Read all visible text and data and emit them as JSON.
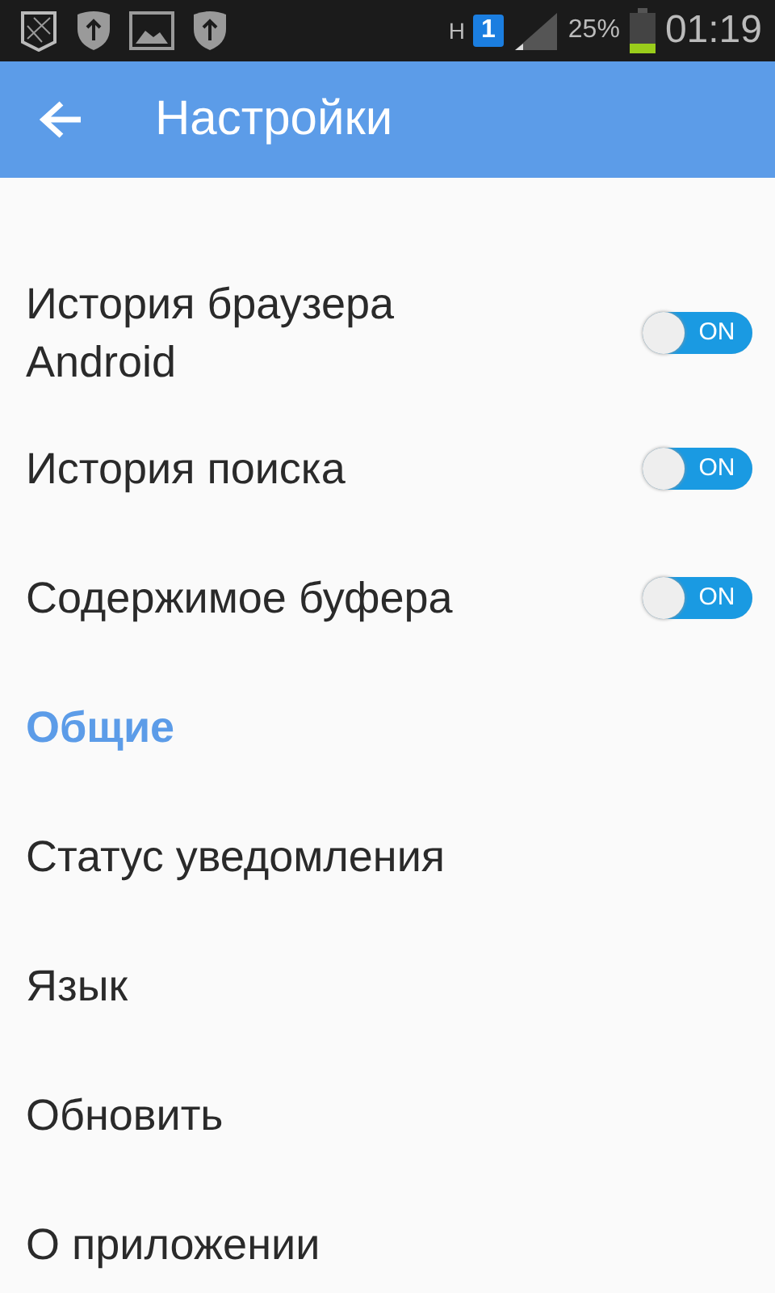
{
  "status_bar": {
    "network": "H",
    "sim": "1",
    "battery_text": "25%",
    "time": "01:19"
  },
  "app_bar": {
    "title": "Настройки"
  },
  "items": [
    {
      "kind": "toggle",
      "label": "История браузера Android",
      "on": true,
      "toggle_text": "ON"
    },
    {
      "kind": "toggle",
      "label": "История поиска",
      "on": true,
      "toggle_text": "ON"
    },
    {
      "kind": "toggle",
      "label": "Содержимое буфера",
      "on": true,
      "toggle_text": "ON"
    },
    {
      "kind": "header",
      "label": "Общие"
    },
    {
      "kind": "plain",
      "label": "Статус уведомления"
    },
    {
      "kind": "plain",
      "label": "Язык"
    },
    {
      "kind": "plain",
      "label": "Обновить"
    },
    {
      "kind": "plain",
      "label": "О приложении"
    }
  ]
}
